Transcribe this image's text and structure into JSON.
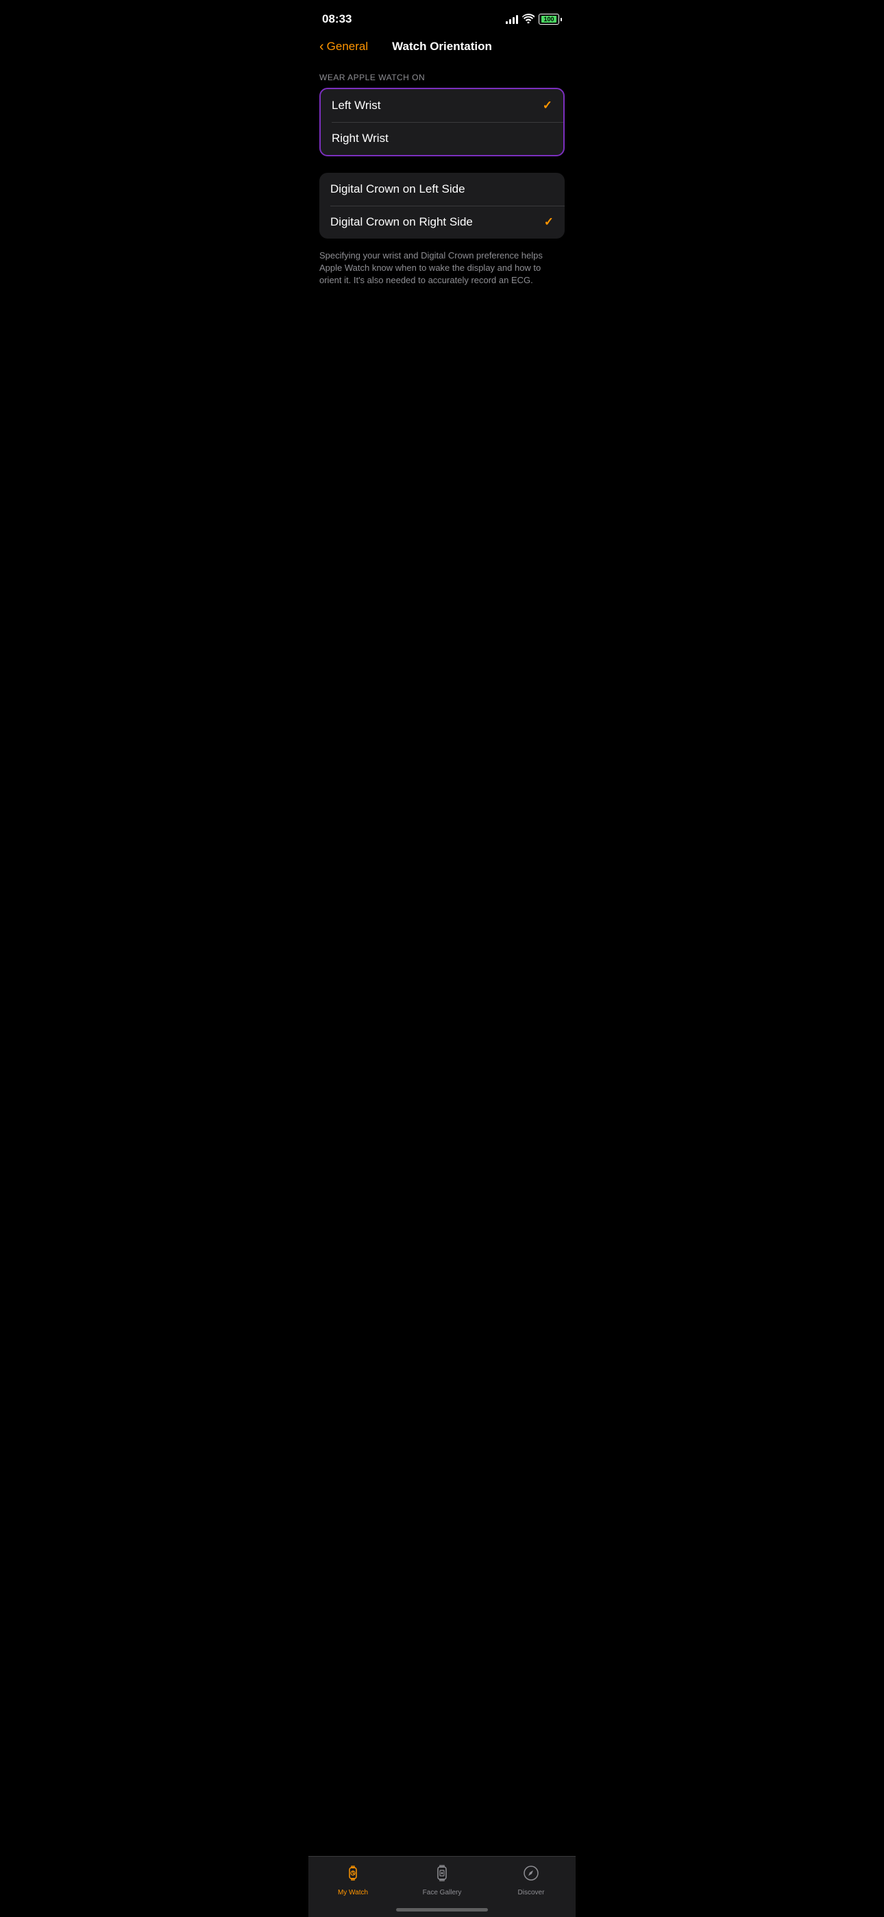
{
  "statusBar": {
    "time": "08:33",
    "battery": "100",
    "batteryColor": "#4cd964"
  },
  "header": {
    "backLabel": "General",
    "title": "Watch Orientation"
  },
  "wristSection": {
    "sectionLabel": "WEAR APPLE WATCH ON",
    "options": [
      {
        "label": "Left Wrist",
        "checked": true
      },
      {
        "label": "Right Wrist",
        "checked": false
      }
    ]
  },
  "crownSection": {
    "options": [
      {
        "label": "Digital Crown on Left Side",
        "checked": false
      },
      {
        "label": "Digital Crown on Right Side",
        "checked": true
      }
    ]
  },
  "helperText": "Specifying your wrist and Digital Crown preference helps Apple Watch know when to wake the display and how to orient it. It's also needed to accurately record an ECG.",
  "tabBar": {
    "tabs": [
      {
        "id": "my-watch",
        "label": "My Watch",
        "active": true
      },
      {
        "id": "face-gallery",
        "label": "Face Gallery",
        "active": false
      },
      {
        "id": "discover",
        "label": "Discover",
        "active": false
      }
    ]
  }
}
